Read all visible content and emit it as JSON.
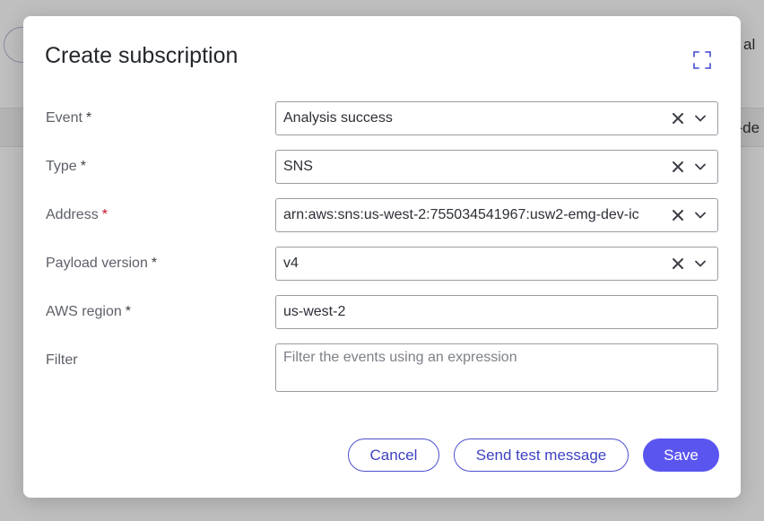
{
  "background": {
    "header_text": "w al",
    "row_text": "g-de"
  },
  "modal": {
    "title": "Create subscription",
    "expand_icon": "expand-icon"
  },
  "form": {
    "event": {
      "label": "Event",
      "required": "*",
      "value": "Analysis success"
    },
    "type": {
      "label": "Type",
      "required": "*",
      "value": "SNS"
    },
    "address": {
      "label": "Address",
      "required": "*",
      "value": "arn:aws:sns:us-west-2:755034541967:usw2-emg-dev-ic"
    },
    "payload_version": {
      "label": "Payload version",
      "required": "*",
      "value": "v4"
    },
    "aws_region": {
      "label": "AWS region",
      "required": "*",
      "value": "us-west-2"
    },
    "filter": {
      "label": "Filter",
      "placeholder": "Filter the events using an expression",
      "value": ""
    }
  },
  "buttons": {
    "cancel": "Cancel",
    "send_test": "Send test message",
    "save": "Save"
  },
  "colors": {
    "accent": "#5b55f0",
    "outline": "#4b50cc",
    "required_red": "#c8102e"
  }
}
